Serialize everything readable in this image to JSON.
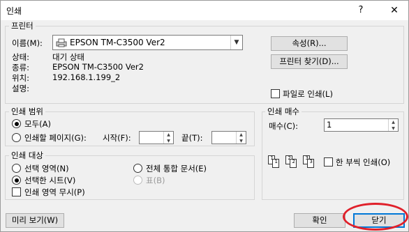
{
  "window": {
    "title": "인쇄",
    "help": "?",
    "close": "✕"
  },
  "printer": {
    "group_label": "프린터",
    "name_label": "이름(M):",
    "name_value": "EPSON TM-C3500 Ver2",
    "status_label": "상태:",
    "status_value": "대기 상태",
    "type_label": "종류:",
    "type_value": "EPSON TM-C3500 Ver2",
    "location_label": "위치:",
    "location_value": "192.168.1.199_2",
    "comment_label": "설명:",
    "properties_button": "속성(R)...",
    "find_printer_button": "프린터 찾기(D)...",
    "print_to_file_label": "파일로 인쇄(L)",
    "print_to_file_checked": false
  },
  "print_range": {
    "group_label": "인쇄 범위",
    "all_label": "모두(A)",
    "all_selected": true,
    "pages_label": "인쇄할 페이지(G):",
    "start_label": "시작(F):",
    "end_label": "끝(T):",
    "start_value": "",
    "end_value": ""
  },
  "copies": {
    "group_label": "인쇄 매수",
    "count_label": "매수(C):",
    "count_value": "1",
    "collate_label": "한 부씩 인쇄(O)",
    "collate_checked": false,
    "collate_icon_pages": [
      "1",
      "1",
      "2",
      "2",
      "3",
      "3"
    ]
  },
  "print_what": {
    "group_label": "인쇄 대상",
    "selection_label": "선택 영역(N)",
    "active_sheets_label": "선택한 시트(V)",
    "active_sheets_selected": true,
    "entire_workbook_label": "전체 통합 문서(E)",
    "table_label": "표(B)",
    "ignore_print_areas_label": "인쇄 영역 무시(P)",
    "ignore_print_areas_checked": false
  },
  "footer": {
    "preview_button": "미리 보기(W)",
    "ok_button": "확인",
    "close_button": "닫기"
  },
  "annotation_color": "#e0202a"
}
